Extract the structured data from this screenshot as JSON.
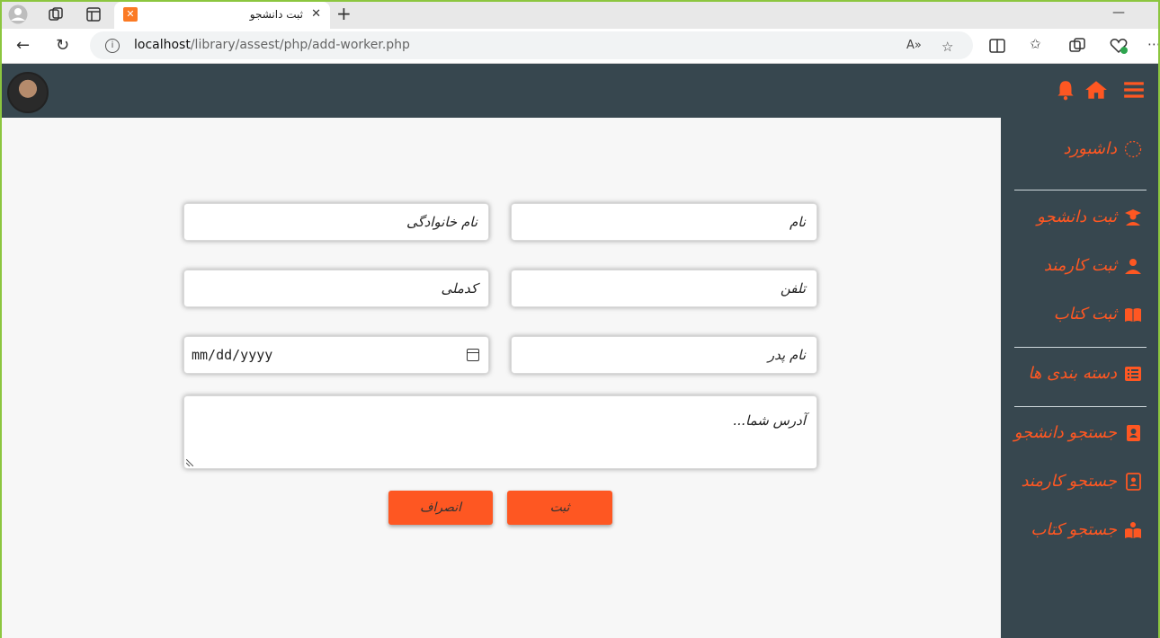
{
  "browser": {
    "tab_title": "ثبت دانشجو",
    "url_host": "localhost",
    "url_path": "/library/assest/php/add-worker.php"
  },
  "sidebar": {
    "items": [
      {
        "label": "داشبورد",
        "icon": "dashboard-circle-icon"
      },
      {
        "label": "ثبت دانشجو",
        "icon": "graduate-icon"
      },
      {
        "label": "ثبت کارمند",
        "icon": "users-icon"
      },
      {
        "label": "ثبت کتاب",
        "icon": "book-open-icon"
      },
      {
        "label": "دسته بندی ها",
        "icon": "list-icon"
      },
      {
        "label": "جستجو دانشجو",
        "icon": "contact-book-icon"
      },
      {
        "label": "جستجو کارمند",
        "icon": "address-book-icon"
      },
      {
        "label": "جستجو کتاب",
        "icon": "reader-icon"
      }
    ]
  },
  "form": {
    "name_placeholder": "نام",
    "family_placeholder": "نام خانوادگی",
    "phone_placeholder": "تلفن",
    "national_code_placeholder": "کدملی",
    "father_name_placeholder": "نام پدر",
    "date_placeholder": "mm/dd/yyyy",
    "address_placeholder": "آدرس شما...",
    "submit_label": "ثبت",
    "cancel_label": "انصراف"
  },
  "colors": {
    "accent": "#fe5722",
    "nav_bg": "#37474f",
    "page_bg": "#f7f7f7"
  }
}
